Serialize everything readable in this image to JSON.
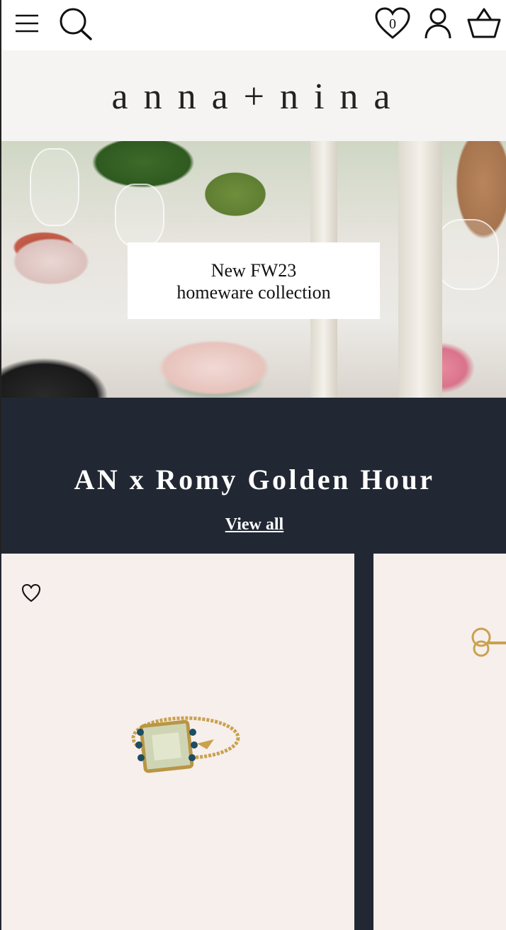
{
  "header": {
    "menu_icon": "hamburger-menu-icon",
    "search_icon": "search-icon",
    "wishlist_icon": "heart-icon",
    "wishlist_count": "0",
    "account_icon": "user-icon",
    "cart_icon": "basket-icon"
  },
  "brand": {
    "logo_text": "anna+nina"
  },
  "hero": {
    "line1": "New FW23",
    "line2": "homeware collection"
  },
  "collection": {
    "title": "AN x Romy Golden Hour",
    "view_all": "View all"
  },
  "products": {
    "items": [
      {
        "image": "gold ring with green stone",
        "favorite_icon": "heart-outline-icon"
      },
      {
        "image": "gold stud earring"
      }
    ]
  },
  "colors": {
    "dark_band": "#222833",
    "card_bg": "#f7efec",
    "logo_band": "#f6f4f3"
  }
}
